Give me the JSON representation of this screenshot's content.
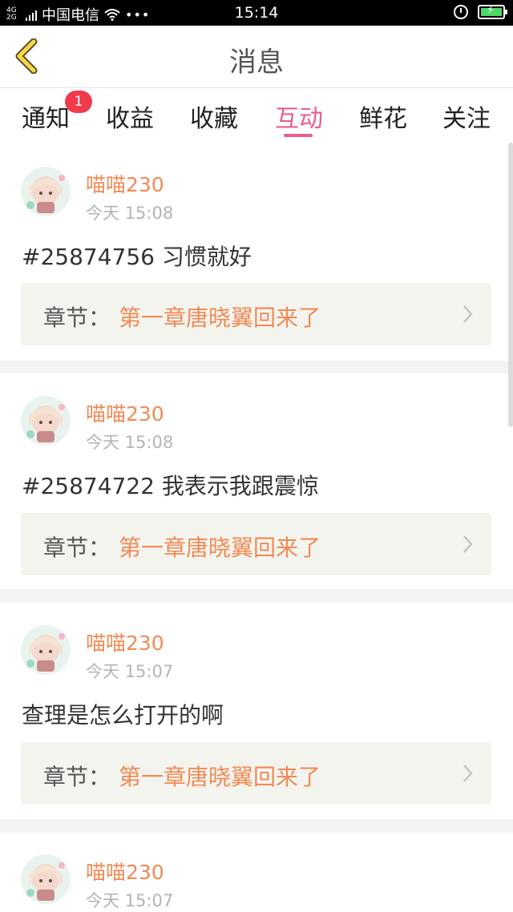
{
  "status_bar": {
    "network": "4G 2G",
    "carrier": "中国电信",
    "more": "•••",
    "time": "15:14"
  },
  "header": {
    "title": "消息"
  },
  "tabs": [
    {
      "label": "通知",
      "badge": "1"
    },
    {
      "label": "收益"
    },
    {
      "label": "收藏"
    },
    {
      "label": "互动",
      "active": true
    },
    {
      "label": "鲜花"
    },
    {
      "label": "关注"
    }
  ],
  "colors": {
    "accent_pink": "#ea5d8f",
    "username_orange": "#f08a54",
    "badge_red": "#ef3b4a"
  },
  "items": [
    {
      "user": "喵喵230",
      "time": "今天 15:08",
      "comment": "#25874756 习惯就好",
      "chapter_label": "章节：",
      "chapter_name": "第一章唐晓翼回来了"
    },
    {
      "user": "喵喵230",
      "time": "今天 15:08",
      "comment": "#25874722 我表示我跟震惊",
      "chapter_label": "章节：",
      "chapter_name": "第一章唐晓翼回来了"
    },
    {
      "user": "喵喵230",
      "time": "今天 15:07",
      "comment": "查理是怎么打开的啊",
      "chapter_label": "章节：",
      "chapter_name": "第一章唐晓翼回来了"
    },
    {
      "user": "喵喵230",
      "time": "今天 15:07"
    }
  ]
}
